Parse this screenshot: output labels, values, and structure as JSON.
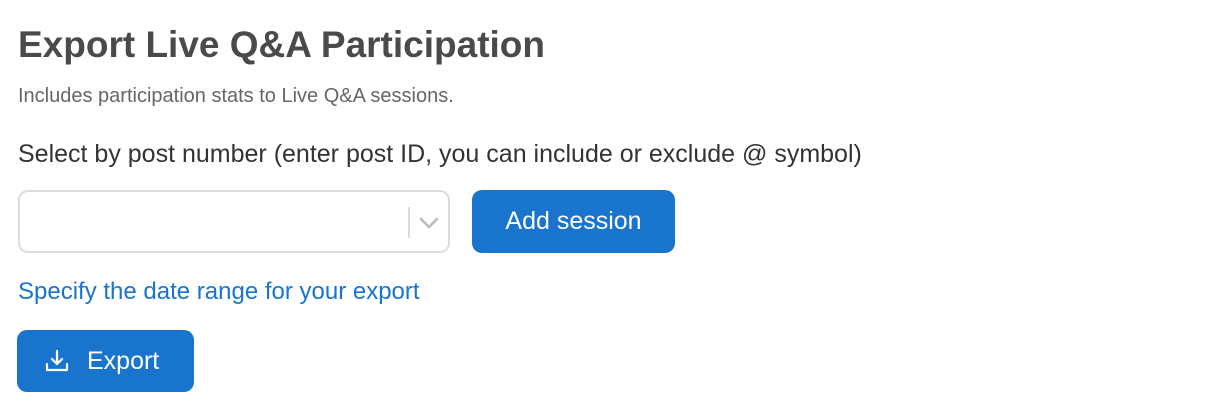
{
  "header": {
    "title": "Export Live Q&A Participation",
    "subtitle": "Includes participation stats to Live Q&A sessions."
  },
  "session_select": {
    "label": "Select by post number (enter post ID, you can include or exclude @ symbol)",
    "value": "",
    "dropdown_icon": "chevron-down-icon"
  },
  "buttons": {
    "add_session": "Add session",
    "export": "Export",
    "export_icon": "download-icon"
  },
  "links": {
    "date_range": "Specify the date range for your export"
  },
  "colors": {
    "primary": "#1874cc",
    "title": "#4a4a4a",
    "subtitle": "#666666",
    "border": "#dddddd"
  }
}
